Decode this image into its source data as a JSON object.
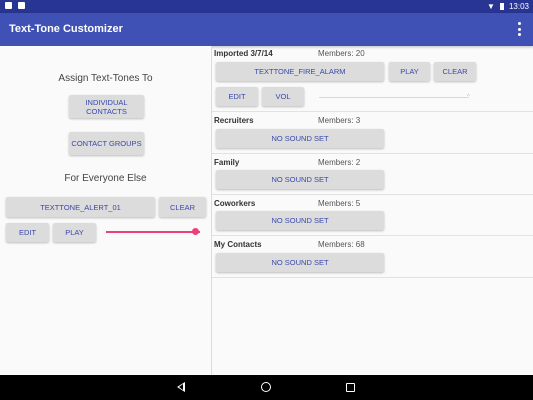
{
  "status_bar": {
    "time": "13:03",
    "icons": [
      "notification-icon",
      "clipboard-icon",
      "wifi-icon",
      "battery-icon"
    ]
  },
  "app_bar": {
    "title": "Text-Tone Customizer",
    "menu_icon": "overflow-menu-icon"
  },
  "left": {
    "assign_heading": "Assign Text-Tones To",
    "individual_contacts": "INDIVIDUAL CONTACTS",
    "contact_groups": "CONTACT GROUPS",
    "everyone_heading": "For Everyone Else",
    "tone": "TEXTTONE_ALERT_01",
    "clear": "CLEAR",
    "edit": "EDIT",
    "play": "PLAY",
    "volume": 0.95
  },
  "groups": [
    {
      "name": "Imported 3/7/14",
      "members": "Members: 20",
      "tone": "TEXTTONE_FIRE_ALARM",
      "play": "PLAY",
      "clear": "CLEAR",
      "edit": "EDIT",
      "vol": "VOL"
    },
    {
      "name": "Recruiters",
      "members": "Members: 3",
      "tone": "NO SOUND SET"
    },
    {
      "name": "Family",
      "members": "Members: 2",
      "tone": "NO SOUND SET"
    },
    {
      "name": "Coworkers",
      "members": "Members: 5",
      "tone": "NO SOUND SET"
    },
    {
      "name": "My Contacts",
      "members": "Members: 68",
      "tone": "NO SOUND SET"
    }
  ],
  "colors": {
    "primary": "#3f51b5",
    "primary_dark": "#283593",
    "accent": "#ec407a",
    "button_text": "#3949ab"
  }
}
